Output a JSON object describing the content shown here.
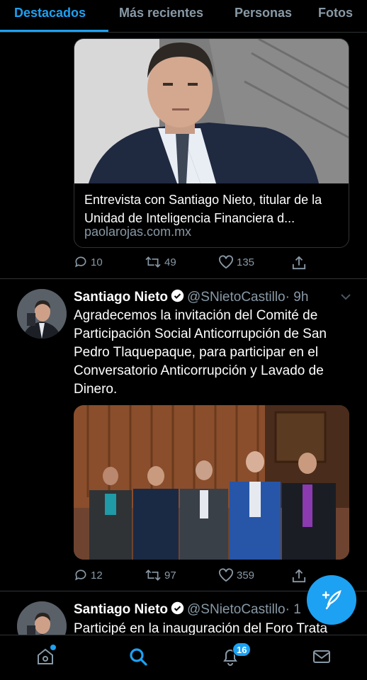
{
  "tabs": [
    {
      "label": "Destacados",
      "active": true
    },
    {
      "label": "Más recientes"
    },
    {
      "label": "Personas"
    },
    {
      "label": "Fotos"
    }
  ],
  "tweet1": {
    "card_title": "Entrevista con Santiago Nieto, titular de la Unidad de Inteligencia Financiera d...",
    "card_domain": "paolarojas.com.mx",
    "replies": "10",
    "retweets": "49",
    "likes": "135"
  },
  "tweet2": {
    "name": "Santiago Nieto",
    "handle": "@SNietoCastillo",
    "time": "· 9h",
    "text": "Agradecemos la invitación del Comité de Participación Social Anticorrupción de San Pedro Tlaquepaque, para participar en el Conversatorio Anticorrupción y Lavado de Dinero.",
    "replies": "12",
    "retweets": "97",
    "likes": "359"
  },
  "tweet3": {
    "name": "Santiago Nieto",
    "handle": "@SNietoCastillo",
    "time": "· 1",
    "text": "Participé en la inauguración del Foro Trata"
  },
  "nav": {
    "notifications_badge": "16"
  },
  "colors": {
    "accent": "#1da1f2",
    "background": "#000000",
    "muted": "#8899a6"
  },
  "icons": [
    "reply-icon",
    "retweet-icon",
    "like-icon",
    "share-icon",
    "verified-icon",
    "chevron-down-icon",
    "compose-icon",
    "home-icon",
    "search-icon",
    "bell-icon",
    "mail-icon"
  ]
}
